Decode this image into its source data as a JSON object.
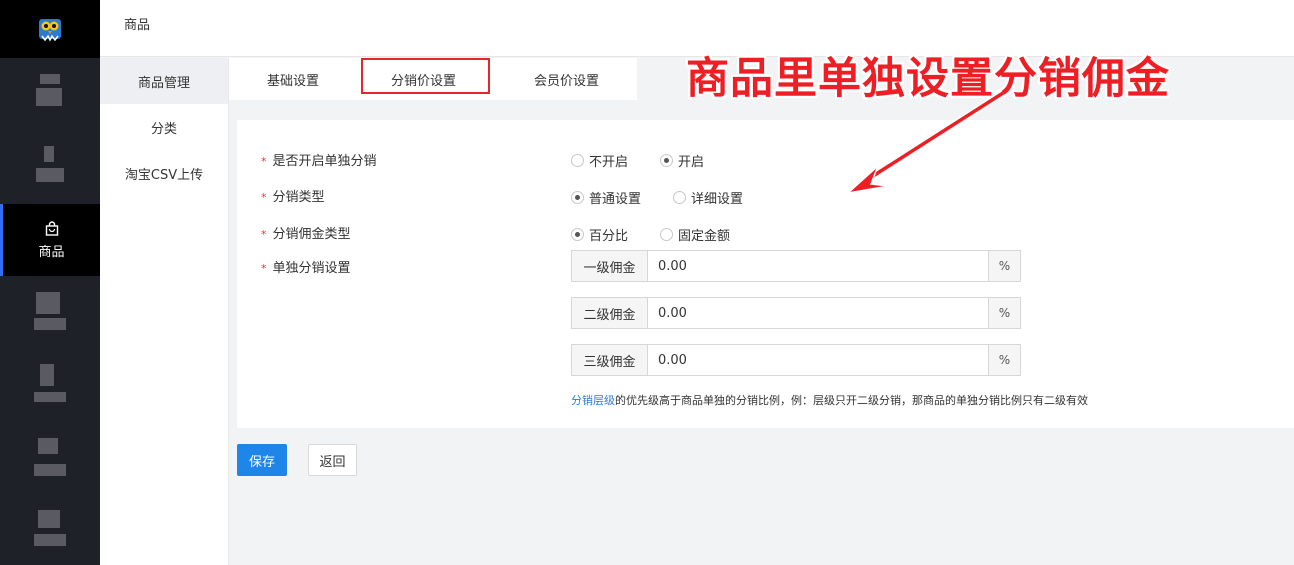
{
  "header": {
    "breadcrumb": "商品"
  },
  "sidebar": {
    "active_item": {
      "label": "商品"
    }
  },
  "subnav": {
    "items": [
      {
        "label": "商品管理",
        "active": true
      },
      {
        "label": "分类",
        "active": false
      },
      {
        "label": "淘宝CSV上传",
        "active": false
      }
    ]
  },
  "tabs": [
    {
      "label": "基础设置"
    },
    {
      "label": "分销价设置"
    },
    {
      "label": "会员价设置"
    }
  ],
  "form": {
    "enable": {
      "label": "是否开启单独分销",
      "options": [
        "不开启",
        "开启"
      ],
      "selected": "开启"
    },
    "type": {
      "label": "分销类型",
      "options": [
        "普通设置",
        "详细设置"
      ],
      "selected": "普通设置"
    },
    "commission_type": {
      "label": "分销佣金类型",
      "options": [
        "百分比",
        "固定金额"
      ],
      "selected": "百分比"
    },
    "single": {
      "label": "单独分销设置",
      "levels": [
        {
          "prefix": "一级佣金",
          "value": "0.00",
          "suffix": "%"
        },
        {
          "prefix": "二级佣金",
          "value": "0.00",
          "suffix": "%"
        },
        {
          "prefix": "三级佣金",
          "value": "0.00",
          "suffix": "%"
        }
      ]
    },
    "hint_link": "分销层级",
    "hint_text": "的优先级高于商品单独的分销比例，例：层级只开二级分销，那商品的单独分销比例只有二级有效",
    "required_mark": "*"
  },
  "buttons": {
    "save": "保存",
    "back": "返回"
  },
  "annotation": {
    "text": "商品里单独设置分销佣金",
    "color": "#ee1f24"
  },
  "colors": {
    "accent": "#1e86e8",
    "sidebar": "#1f2128",
    "highlight_box": "#e3272c"
  }
}
